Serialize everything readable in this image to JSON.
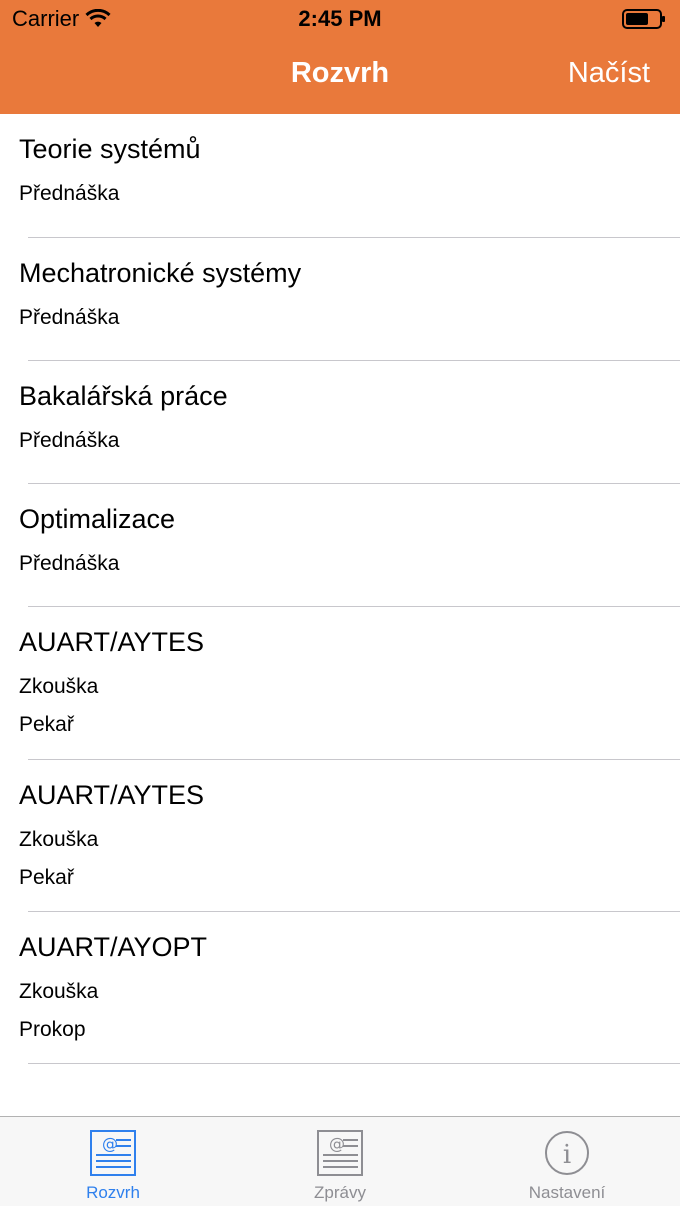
{
  "status_bar": {
    "carrier": "Carrier",
    "time": "2:45 PM"
  },
  "nav": {
    "title": "Rozvrh",
    "right_button": "Načíst",
    "color": "#E9793B"
  },
  "items": [
    {
      "title": "Teorie systémů",
      "lines": [
        "Přednáška"
      ]
    },
    {
      "title": "Mechatronické systémy",
      "lines": [
        "Přednáška"
      ]
    },
    {
      "title": "Bakalářská práce",
      "lines": [
        "Přednáška"
      ]
    },
    {
      "title": "Optimalizace",
      "lines": [
        "Přednáška"
      ]
    },
    {
      "title": "AUART/AYTES",
      "lines": [
        "Zkouška",
        "Pekař"
      ]
    },
    {
      "title": "AUART/AYTES",
      "lines": [
        "Zkouška",
        "Pekař"
      ]
    },
    {
      "title": "AUART/AYOPT",
      "lines": [
        "Zkouška",
        "Prokop"
      ]
    }
  ],
  "tabs": [
    {
      "label": "Rozvrh",
      "icon": "schedule-icon",
      "active": true
    },
    {
      "label": "Zprávy",
      "icon": "news-icon",
      "active": false
    },
    {
      "label": "Nastavení",
      "icon": "info-icon",
      "active": false
    }
  ],
  "colors": {
    "tab_active": "#2F80ED",
    "tab_inactive": "#8E8E93",
    "separator": "#C8C7CC"
  }
}
